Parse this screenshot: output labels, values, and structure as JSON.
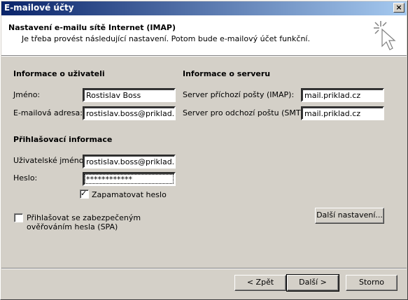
{
  "window": {
    "title": "E-mailové účty",
    "close_glyph": "×"
  },
  "header": {
    "title": "Nastavení e-mailu sítě Internet (IMAP)",
    "description": "Je třeba provést následující nastavení. Potom bude e-mailový účet funkční.",
    "icon": "wizard-cursor-icon"
  },
  "user_info": {
    "heading": "Informace o uživateli",
    "name_label": "Jméno:",
    "name_value": "Rostislav Boss",
    "email_label": "E-mailová adresa:",
    "email_value": "rostislav.boss@priklad.cz"
  },
  "server_info": {
    "heading": "Informace o serveru",
    "incoming_label": "Server příchozí pošty (IMAP):",
    "incoming_value": "mail.priklad.cz",
    "outgoing_label": "Server pro odchozí poštu (SMTP):",
    "outgoing_value": "mail.priklad.cz"
  },
  "login_info": {
    "heading": "Přihlašovací informace",
    "username_label": "Uživatelské jméno:",
    "username_value": "rostislav.boss@priklad.cz",
    "password_label": "Heslo:",
    "password_value": "************",
    "remember_label": "Zapamatovat heslo",
    "remember_checked": true
  },
  "spa": {
    "label_line1": "Přihlašovat se zabezpečeným",
    "label_line2": "ověřováním hesla (SPA)",
    "checked": false
  },
  "buttons": {
    "more_settings": "Další nastavení...",
    "back": "< Zpět",
    "next": "Další >",
    "cancel": "Storno"
  }
}
